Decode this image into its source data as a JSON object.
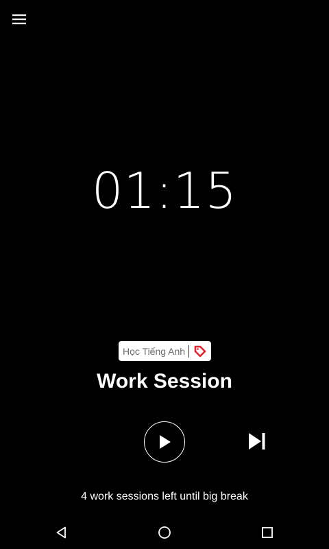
{
  "header": {
    "menu_icon": "hamburger-menu-icon"
  },
  "timer": {
    "display": "01:15"
  },
  "tag": {
    "label": "Học Tiếng Anh",
    "icon": "label-tag-icon",
    "icon_color": "#e0262b",
    "background": "#ffffff"
  },
  "session": {
    "title": "Work Session",
    "sessions_left_text": "4 work sessions left until big break"
  },
  "controls": {
    "play_icon": "play-icon",
    "skip_icon": "skip-next-icon"
  },
  "nav_bar": {
    "back_icon": "back-triangle-icon",
    "home_icon": "home-circle-icon",
    "recents_icon": "recents-square-icon"
  },
  "colors": {
    "background": "#000000",
    "foreground": "#ffffff"
  }
}
